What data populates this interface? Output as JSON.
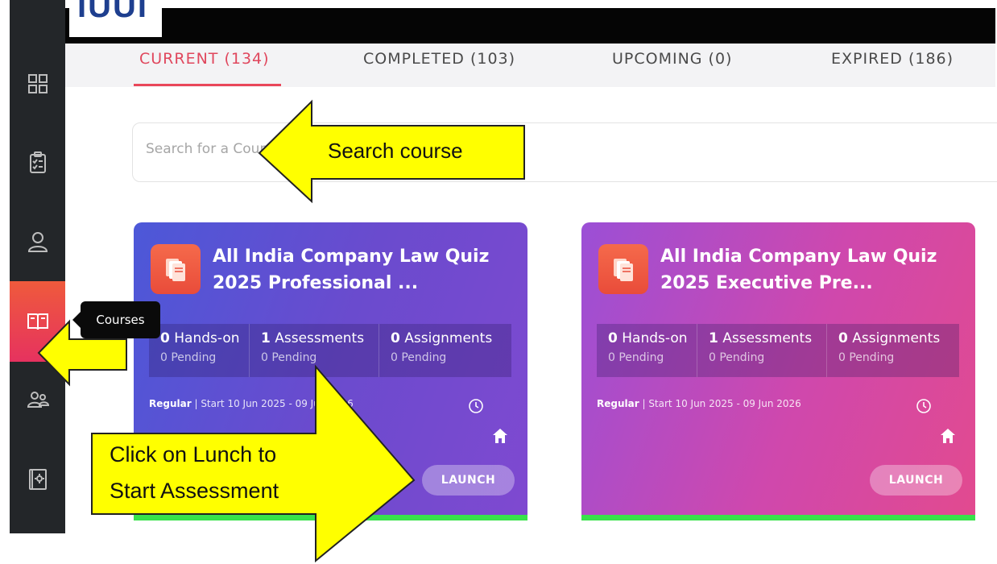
{
  "logo": {
    "text": "IUUI"
  },
  "sidebar": {
    "items": [
      {
        "icon": "dashboard-grid-icon"
      },
      {
        "icon": "clipboard-checklist-icon"
      },
      {
        "icon": "user-profile-icon"
      },
      {
        "icon": "open-book-icon",
        "active": true
      },
      {
        "icon": "users-group-icon"
      },
      {
        "icon": "settings-book-icon"
      }
    ]
  },
  "tooltip": {
    "label": "Courses"
  },
  "tabs": [
    {
      "label": "CURRENT (134)",
      "active": true
    },
    {
      "label": "COMPLETED (103)"
    },
    {
      "label": "UPCOMING (0)"
    },
    {
      "label": "EXPIRED (186)"
    }
  ],
  "search": {
    "placeholder": "Search for a Course"
  },
  "cards": [
    {
      "title_line1": "All India Company Law Quiz",
      "title_line2": "2025 Professional ...",
      "stats": [
        {
          "count": "0",
          "label": "Hands-on",
          "pending": "0 Pending"
        },
        {
          "count": "1",
          "label": "Assessments",
          "pending": "0 Pending"
        },
        {
          "count": "0",
          "label": "Assignments",
          "pending": "0 Pending"
        }
      ],
      "type": "Regular",
      "dates": "Start 10 Jun 2025 - 09 Jun 2026",
      "launch_label": "LAUNCH"
    },
    {
      "title_line1": "All India Company Law Quiz",
      "title_line2": "2025 Executive Pre...",
      "stats": [
        {
          "count": "0",
          "label": "Hands-on",
          "pending": "0 Pending"
        },
        {
          "count": "1",
          "label": "Assessments",
          "pending": "0 Pending"
        },
        {
          "count": "0",
          "label": "Assignments",
          "pending": "0 Pending"
        }
      ],
      "type": "Regular",
      "dates": "Start 10 Jun 2025 - 09 Jun 2026",
      "launch_label": "LAUNCH"
    }
  ],
  "annotations": {
    "search_callout": "Search course",
    "launch_callout_line1": "Click on Lunch to",
    "launch_callout_line2": "Start Assessment",
    "callout_fill": "#ffff00",
    "callout_stroke": "#222222"
  },
  "colors": {
    "accent": "#e0475d",
    "sidebar_bg": "#232629",
    "card1_start": "#4c58d8",
    "card1_end": "#7f49d0",
    "card2_start": "#9b4fd6",
    "card2_end": "#e24a8f",
    "card_progress": "#38e24a"
  }
}
